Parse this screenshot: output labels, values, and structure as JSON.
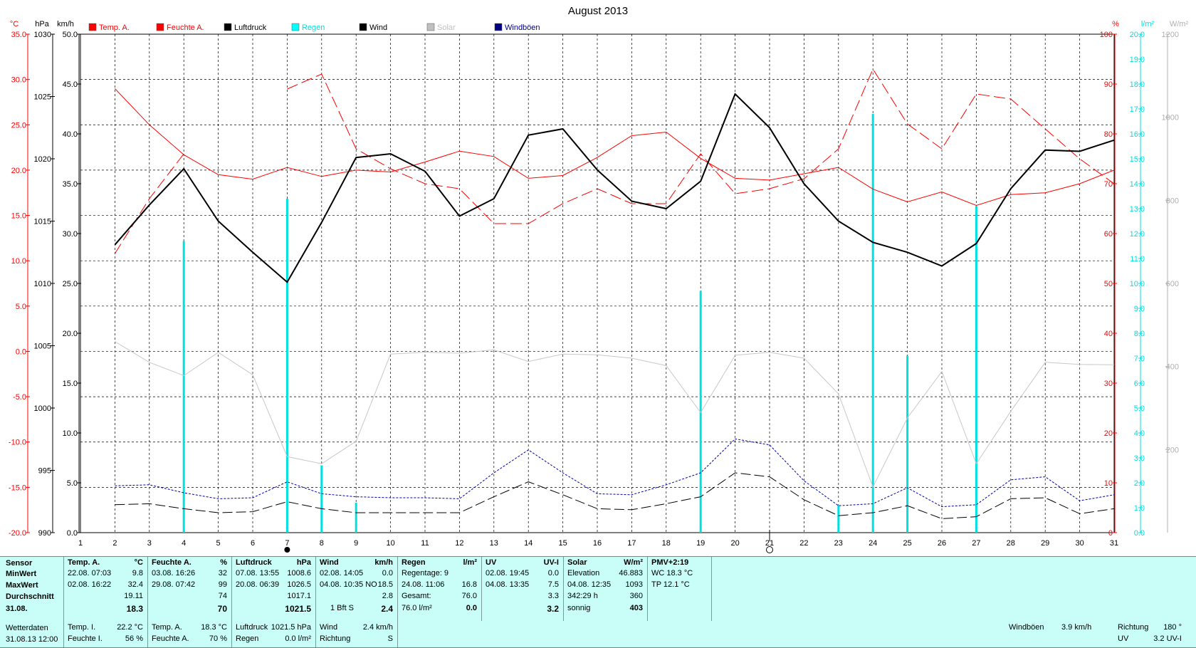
{
  "chart_data": {
    "type": "line",
    "title": "August 2013",
    "x": [
      2,
      3,
      4,
      5,
      6,
      7,
      8,
      9,
      10,
      11,
      12,
      13,
      14,
      15,
      16,
      17,
      18,
      19,
      20,
      21,
      22,
      23,
      24,
      25,
      26,
      27,
      28,
      29,
      30,
      31
    ],
    "xticks": [
      1,
      2,
      3,
      4,
      5,
      6,
      7,
      8,
      9,
      10,
      11,
      12,
      13,
      14,
      15,
      16,
      17,
      18,
      19,
      20,
      21,
      22,
      23,
      24,
      25,
      26,
      27,
      28,
      29,
      30,
      31
    ],
    "axes": {
      "temp": {
        "unit": "°C",
        "min": -20,
        "max": 35,
        "step": 5,
        "color": "#ff0000",
        "ticks": [
          "35.0",
          "30.0",
          "25.0",
          "20.0",
          "15.0",
          "10.0",
          "5.0",
          "0.0",
          "-5.0",
          "-10.0",
          "-15.0",
          "-20.0"
        ]
      },
      "pressure": {
        "unit": "hPa",
        "min": 990,
        "max": 1030,
        "step": 5,
        "color": "#000000",
        "ticks": [
          "1030",
          "1025",
          "1020",
          "1015",
          "1010",
          "1005",
          "1000",
          "995",
          "990"
        ]
      },
      "wind": {
        "unit": "km/h",
        "min": 0,
        "max": 50,
        "step": 5,
        "color": "#000000",
        "ticks": [
          "50.0",
          "45.0",
          "40.0",
          "35.0",
          "30.0",
          "25.0",
          "20.0",
          "15.0",
          "10.0",
          "5.0",
          "0.0"
        ]
      },
      "humidity": {
        "unit": "%",
        "min": 0,
        "max": 100,
        "step": 10,
        "color": "#ff0000",
        "ticks": [
          "100",
          "90",
          "80",
          "70",
          "60",
          "50",
          "40",
          "30",
          "20",
          "10",
          "0"
        ]
      },
      "rain": {
        "unit": "l/m²",
        "min": 0,
        "max": 20,
        "step": 1,
        "color": "#00e0e0",
        "ticks": [
          "20.0",
          "19.0",
          "18.0",
          "17.0",
          "16.0",
          "15.0",
          "14.0",
          "13.0",
          "12.0",
          "11.0",
          "10.0",
          "9.0",
          "8.0",
          "7.0",
          "6.0",
          "5.0",
          "4.0",
          "3.0",
          "2.0",
          "1.0",
          "0.0"
        ]
      },
      "solar": {
        "unit": "W/m²",
        "min": 0,
        "max": 1200,
        "step": 200,
        "color": "#b0b0b0",
        "ticks": [
          "1200",
          "1000",
          "800",
          "600",
          "400",
          "200"
        ]
      }
    },
    "legend": [
      {
        "name": "Temp. A.",
        "color": "#ff0000"
      },
      {
        "name": "Feuchte A.",
        "color": "#ff0000"
      },
      {
        "name": "Luftdruck",
        "color": "#000000"
      },
      {
        "name": "Regen",
        "color": "#00ffff"
      },
      {
        "name": "Wind",
        "color": "#000000"
      },
      {
        "name": "Solar",
        "color": "#c0c0c0"
      },
      {
        "name": "Windböen",
        "color": "#000080"
      }
    ],
    "series": [
      {
        "name": "Temp. A.",
        "axis": "temp",
        "color": "#ff0000",
        "dash": "",
        "width": 1,
        "values": [
          null,
          null,
          21.7,
          19.5,
          19.0,
          20.3,
          19.3,
          20.0,
          19.8,
          20.9,
          22.1,
          21.5,
          19.1,
          19.4,
          21.4,
          23.8,
          24.2,
          21.3,
          19.1,
          18.9,
          19.6,
          20.3,
          17.9,
          16.5,
          17.6,
          16.1,
          17.3,
          17.5,
          18.5,
          20.0
        ]
      },
      {
        "name": "Temp. A. (Tagesverlauf)",
        "axis": "temp",
        "color": "#ff0000",
        "dash": "",
        "width": 1,
        "values": [
          29.0,
          25.0,
          21.7
        ]
      },
      {
        "name": "Feuchte A.",
        "axis": "humidity",
        "color": "#ff0000",
        "dash": "16,6",
        "width": 1,
        "values": [
          56,
          67,
          76,
          null,
          null,
          89,
          92,
          77,
          73,
          70,
          69,
          62,
          62,
          66,
          69,
          66,
          66,
          76,
          68,
          69,
          71,
          77,
          93,
          82,
          77,
          88,
          87,
          81,
          75,
          70
        ]
      },
      {
        "name": "Luftdruck",
        "axis": "pressure",
        "color": "#000000",
        "dash": "",
        "width": 2,
        "values": [
          1013.1,
          1016.3,
          1019.2,
          1015.0,
          1012.5,
          1010.1,
          1014.9,
          1020.1,
          1020.4,
          1019.0,
          1015.4,
          1016.8,
          1021.9,
          1022.4,
          1019.1,
          1016.6,
          1016.0,
          1018.2,
          1025.2,
          1022.5,
          1018.0,
          1015.0,
          1013.3,
          1012.5,
          1011.4,
          1013.2,
          1017.6,
          1020.7,
          1020.6,
          1021.5
        ]
      },
      {
        "name": "Wind",
        "axis": "wind",
        "color": "#000000",
        "dash": "14,5",
        "width": 1,
        "values": [
          2.8,
          2.9,
          2.4,
          2.0,
          2.1,
          3.1,
          2.4,
          2.0,
          2.0,
          2.0,
          2.0,
          3.6,
          5.1,
          3.8,
          2.4,
          2.3,
          2.9,
          3.6,
          6.0,
          5.6,
          3.3,
          1.7,
          2.0,
          2.7,
          1.4,
          1.6,
          3.4,
          3.5,
          1.9,
          2.4
        ]
      },
      {
        "name": "Windböen",
        "axis": "wind",
        "color": "#0000aa",
        "dash": "3,2",
        "width": 1,
        "values": [
          4.7,
          4.8,
          4.0,
          3.4,
          3.5,
          5.1,
          3.9,
          3.6,
          3.5,
          3.5,
          3.4,
          6.0,
          8.3,
          6.0,
          3.9,
          3.8,
          4.8,
          6.0,
          9.4,
          8.8,
          5.2,
          2.7,
          2.9,
          4.5,
          2.6,
          2.8,
          5.3,
          5.6,
          3.2,
          3.8
        ]
      },
      {
        "name": "Solar",
        "axis": "solar",
        "color": "#c8c8c8",
        "dash": "",
        "width": 1,
        "values": [
          460,
          410,
          378,
          434,
          380,
          183,
          166,
          220,
          430,
          434,
          432,
          440,
          412,
          430,
          428,
          420,
          402,
          289,
          427,
          434,
          420,
          334,
          110,
          276,
          388,
          166,
          292,
          410,
          405,
          404
        ]
      }
    ],
    "rain": {
      "axis": "rain",
      "color": "#00e0e0",
      "bars": [
        [
          4,
          11.7
        ],
        [
          7,
          13.4
        ],
        [
          8,
          2.7
        ],
        [
          9,
          1.2
        ],
        [
          19,
          9.7
        ],
        [
          23,
          1.1
        ],
        [
          24,
          16.8
        ],
        [
          25,
          7.1
        ],
        [
          27,
          13.1
        ]
      ]
    },
    "markers": [
      {
        "x": 7,
        "type": "filled-circle"
      },
      {
        "x": 21,
        "type": "open-circle"
      }
    ]
  },
  "stats": {
    "sensor": {
      "h": "Sensor",
      "rows": [
        "MinWert",
        "MaxWert",
        "Durchschnitt"
      ],
      "date": "31.08."
    },
    "temp": {
      "h": "Temp. A.",
      "u": "°C",
      "min": {
        "d": "22.08.  07:03",
        "v": "9.8"
      },
      "max": {
        "d": "02.08.  16:22",
        "v": "32.4"
      },
      "avg": "19.11",
      "today": "18.3"
    },
    "hum": {
      "h": "Feuchte A.",
      "u": "%",
      "min": {
        "d": "03.08.  16:26",
        "v": "32"
      },
      "max": {
        "d": "29.08.  07:42",
        "v": "99"
      },
      "avg": "74",
      "today": "70"
    },
    "press": {
      "h": "Luftdruck",
      "u": "hPa",
      "min": {
        "d": "07.08.  13:55",
        "v": "1008.6"
      },
      "max": {
        "d": "20.08.  06:39",
        "v": "1026.5"
      },
      "avg": "1017.1",
      "today": "1021.5"
    },
    "wind": {
      "h": "Wind",
      "u": "km/h",
      "min": {
        "d": "02.08.  14:05",
        "v": "0.0"
      },
      "max": {
        "d": "04.08.  10:35 NO",
        "v": "18.5"
      },
      "avg": "2.8",
      "today_l": "1 Bft S",
      "today": "2.4"
    },
    "rain": {
      "h": "Regen",
      "u": "l/m²",
      "r1": {
        "d": "Regentage: 9",
        "v": ""
      },
      "r2": {
        "d": "24.08.  11:06",
        "v": "16.8"
      },
      "r3": {
        "d": "Gesamt:",
        "v": "76.0"
      },
      "r4": {
        "d": "76.0 l/m²",
        "v": "0.0"
      }
    },
    "uv": {
      "h": "UV",
      "u": "UV-I",
      "min": {
        "d": "02.08.  19:45",
        "v": "0.0"
      },
      "max": {
        "d": "04.08.  13:35",
        "v": "7.5"
      },
      "avg": "3.3",
      "today": "3.2"
    },
    "solar": {
      "h": "Solar",
      "u": "W/m²",
      "r1": {
        "d": "Elevation",
        "v": "46.883"
      },
      "r2": {
        "d": "04.08.  12:35",
        "v": "1093"
      },
      "r3": {
        "d": "342:29 h",
        "v": "360"
      },
      "r4": {
        "d": "sonnig",
        "v": "403"
      }
    },
    "pmv": {
      "h": "PMV+2:19",
      "wc": "WC 18.3 °C",
      "tp": "TP 12.1 °C"
    }
  },
  "footer": {
    "c1": [
      "Wetterdaten",
      "31.08.13 12:00"
    ],
    "c2": [
      [
        "Temp. I.",
        "22.2 °C"
      ],
      [
        "Feuchte I.",
        "56 %"
      ]
    ],
    "c3": [
      [
        "Temp. A.",
        "18.3 °C"
      ],
      [
        "Feuchte A.",
        "70 %"
      ]
    ],
    "c4": [
      [
        "Luftdruck",
        "1021.5 hPa"
      ],
      [
        "Regen",
        "0.0 l/m²"
      ]
    ],
    "c5": [
      [
        "Wind",
        "2.4 km/h"
      ],
      [
        "Richtung",
        "S"
      ]
    ],
    "right": [
      [
        "Windböen",
        "3.9 km/h",
        "Richtung",
        "180 °"
      ],
      [
        "",
        "",
        "UV",
        "3.2 UV-I"
      ]
    ]
  }
}
